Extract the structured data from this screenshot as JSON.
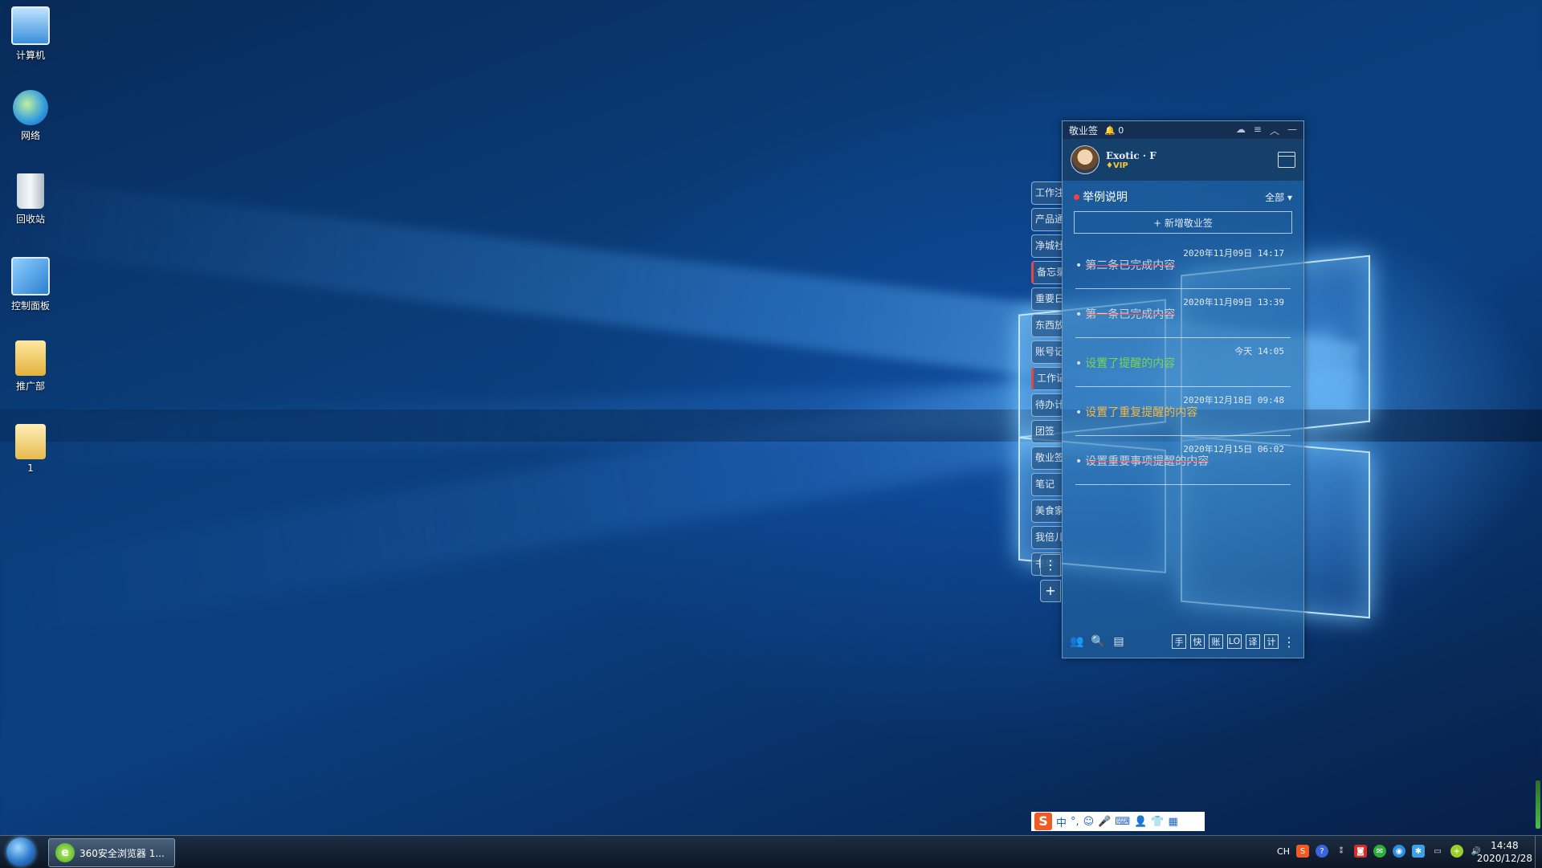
{
  "desktop": {
    "icons": [
      {
        "label": "计算机",
        "icon": "computer-icon"
      },
      {
        "label": "网络",
        "icon": "network-icon"
      },
      {
        "label": "回收站",
        "icon": "recycle-bin-icon"
      },
      {
        "label": "控制面板",
        "icon": "control-panel-icon"
      },
      {
        "label": "推广部",
        "icon": "folder-user-icon"
      },
      {
        "label": "1",
        "icon": "folder-icon"
      }
    ]
  },
  "note_app": {
    "title": "敬业签",
    "notification_count": "0",
    "user": {
      "name": "Exotic · F",
      "badge": "VIP"
    },
    "section_title": "举例说明",
    "filter": "全部",
    "add_button": "+ 新增敬业签",
    "items": [
      {
        "text": "第二条已完成内容",
        "time": "2020年11月09日 14:17",
        "style": "done"
      },
      {
        "text": "第一条已完成内容",
        "time": "2020年11月09日 13:39",
        "style": "done"
      },
      {
        "text": "设置了提醒的内容",
        "time": "今天 14:05",
        "style": "green"
      },
      {
        "text": "设置了重复提醒的内容",
        "time": "2020年12月18日 09:48",
        "style": "orange"
      },
      {
        "text": "设置重要事项提醒的内容",
        "time": "2020年12月15日 06:02",
        "style": "done"
      }
    ],
    "footer_buttons": [
      "手",
      "快",
      "账",
      "LO",
      "译",
      "计"
    ],
    "tabs": [
      "工作注",
      "产品通",
      "净城社",
      "备忘录",
      "重要日",
      "东西放",
      "账号记",
      "工作记",
      "待办计",
      "团签",
      "敬业签",
      "笔记",
      "美食家",
      "我倍儿",
      "书单"
    ],
    "tab_more": "⋮",
    "tab_add": "+"
  },
  "ime": {
    "logo": "S",
    "mode": "中",
    "punct": "°,",
    "icons": [
      "☺",
      "🎤",
      "⌨",
      "👤",
      "👕",
      "▦"
    ]
  },
  "taskbar": {
    "task_label": "360安全浏览器 1...",
    "tray_lang": "CH",
    "clock_time": "14:48",
    "clock_date": "2020/12/28"
  },
  "colors": {
    "done_strike": "#ff4a4a",
    "reminder": "#78d454",
    "repeat": "#f1b94a",
    "accent": "#1f5fbf"
  }
}
